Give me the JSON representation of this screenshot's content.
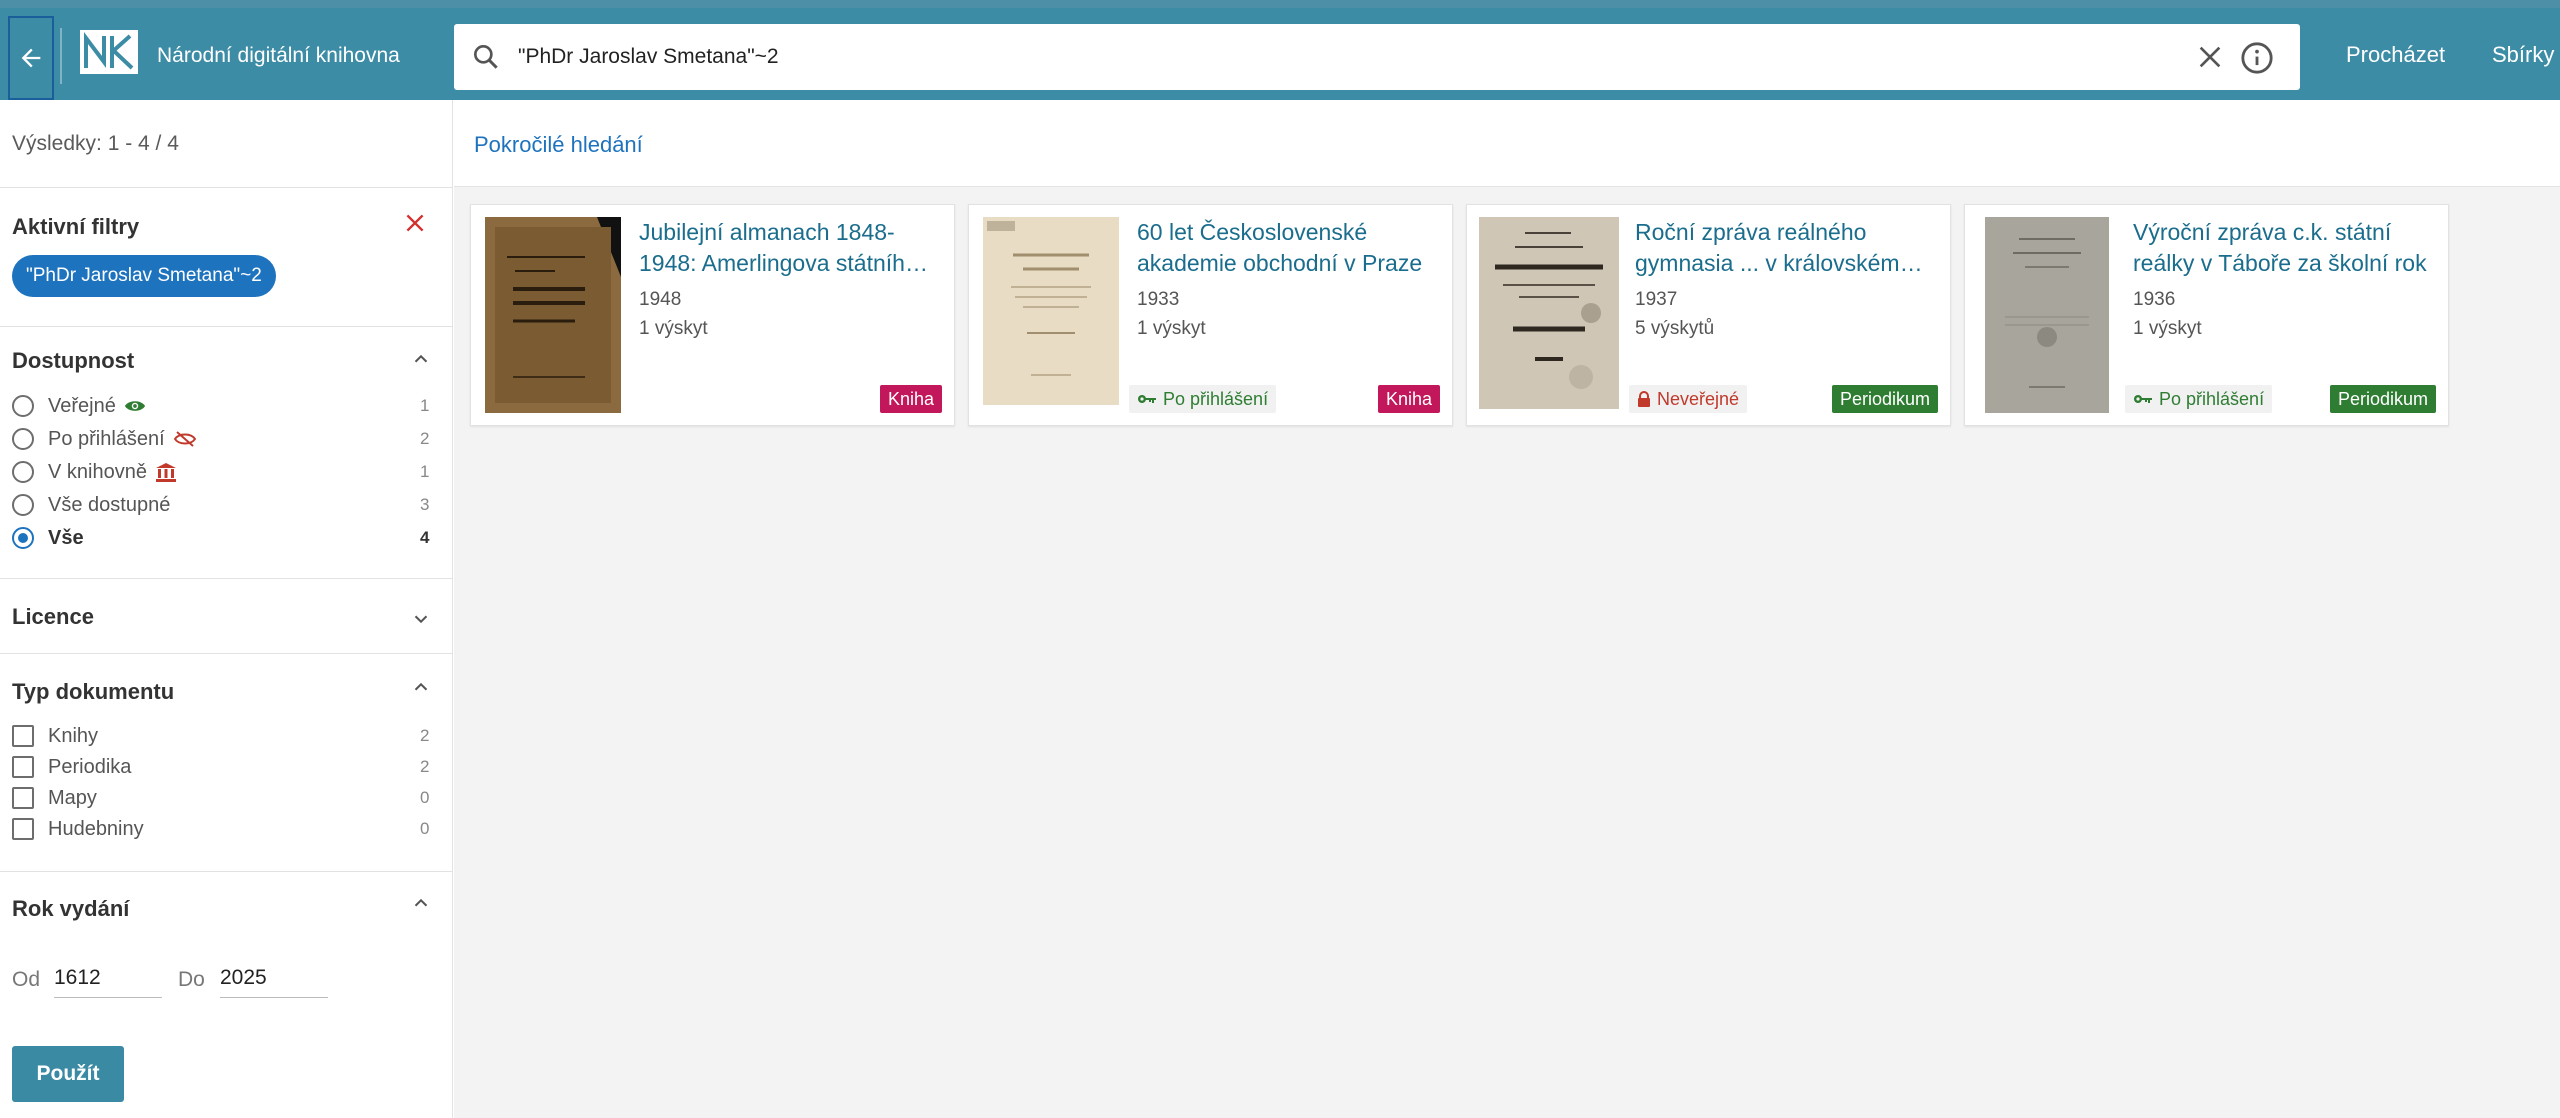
{
  "header": {
    "app_title": "Národní digitální knihovna",
    "search_value": "\"PhDr Jaroslav Smetana\"~2",
    "nav": [
      "Procházet",
      "Sbírky"
    ]
  },
  "sidebar": {
    "results_count": "Výsledky: 1 - 4 / 4",
    "active_filters": {
      "title": "Aktivní filtry",
      "chip": "\"PhDr Jaroslav Smetana\"~2"
    },
    "availability": {
      "title": "Dostupnost",
      "options": [
        {
          "label": "Veřejné",
          "count": "1",
          "icon": "eye-icon",
          "color": "#2e7d32"
        },
        {
          "label": "Po přihlášení",
          "count": "2",
          "icon": "eye-off-icon",
          "color": "#c0392b"
        },
        {
          "label": "V knihovně",
          "count": "1",
          "icon": "library-icon",
          "color": "#c0392b"
        },
        {
          "label": "Vše dostupné",
          "count": "3"
        },
        {
          "label": "Vše",
          "count": "4",
          "selected": true
        }
      ]
    },
    "licence": {
      "title": "Licence"
    },
    "doc_type": {
      "title": "Typ dokumentu",
      "options": [
        {
          "label": "Knihy",
          "count": "2"
        },
        {
          "label": "Periodika",
          "count": "2"
        },
        {
          "label": "Mapy",
          "count": "0"
        },
        {
          "label": "Hudebniny",
          "count": "0"
        }
      ]
    },
    "year": {
      "title": "Rok vydání",
      "from_label": "Od",
      "from_value": "1612",
      "to_label": "Do",
      "to_value": "2025",
      "apply_label": "Použít"
    }
  },
  "main": {
    "advanced_search": "Pokročilé hledání",
    "results": [
      {
        "title": "Jubilejní almanach 1848-1948: Amerlingova státníh…",
        "year": "1948",
        "hits": "1 výskyt",
        "type": "Kniha",
        "type_color": "#c2185b",
        "access": ""
      },
      {
        "title": "60 let Československé akademie obchodní v Praze",
        "year": "1933",
        "hits": "1 výskyt",
        "type": "Kniha",
        "type_color": "#c2185b",
        "access": "Po přihlášení",
        "access_icon": "key-icon"
      },
      {
        "title": "Roční zpráva reálného gymnasia ... v královském…",
        "year": "1937",
        "hits": "5 výskytů",
        "type": "Periodikum",
        "type_color": "#2e7d32",
        "access": "Neveřejné",
        "access_icon": "lock-icon"
      },
      {
        "title": "Výroční zpráva c.k. státní reálky v Táboře za školní rok",
        "year": "1936",
        "hits": "1 výskyt",
        "type": "Periodikum",
        "type_color": "#2e7d32",
        "access": "Po přihlášení",
        "access_icon": "key-icon"
      }
    ]
  }
}
